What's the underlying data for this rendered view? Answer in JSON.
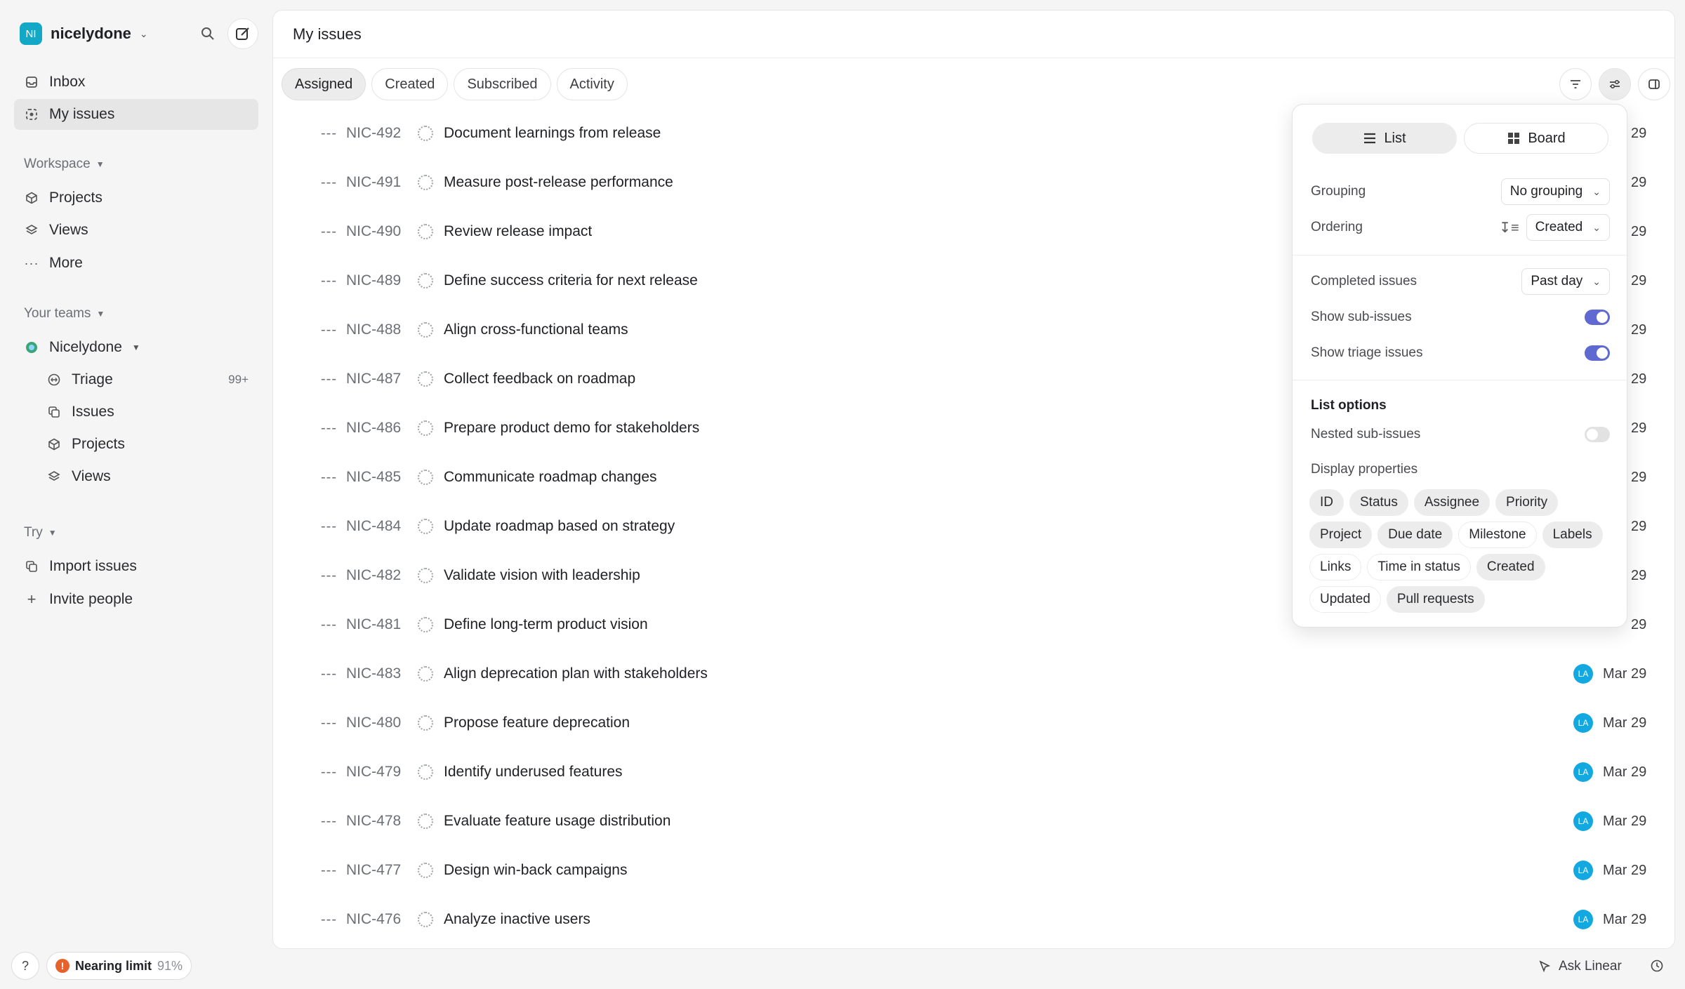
{
  "workspace": {
    "initials": "NI",
    "name": "nicelydone"
  },
  "nav": {
    "inbox": "Inbox",
    "my_issues": "My issues",
    "workspace_label": "Workspace",
    "projects": "Projects",
    "views": "Views",
    "more": "More",
    "your_teams_label": "Your teams",
    "team_name": "Nicelydone",
    "triage": "Triage",
    "triage_count": "99+",
    "issues": "Issues",
    "team_projects": "Projects",
    "team_views": "Views",
    "try_label": "Try",
    "import_issues": "Import issues",
    "invite_people": "Invite people"
  },
  "footer": {
    "help": "?",
    "limit_label": "Nearing limit",
    "limit_pct": "91%",
    "ask_linear": "Ask Linear"
  },
  "header": {
    "title": "My issues"
  },
  "tabs": [
    {
      "label": "Assigned"
    },
    {
      "label": "Created"
    },
    {
      "label": "Subscribed"
    },
    {
      "label": "Activity"
    }
  ],
  "issues": [
    {
      "id": "NIC-492",
      "title": "Document learnings from release",
      "date": "29"
    },
    {
      "id": "NIC-491",
      "title": "Measure post-release performance",
      "date": "29"
    },
    {
      "id": "NIC-490",
      "title": "Review release impact",
      "date": "29"
    },
    {
      "id": "NIC-489",
      "title": "Define success criteria for next release",
      "date": "29"
    },
    {
      "id": "NIC-488",
      "title": "Align cross-functional teams",
      "date": "29"
    },
    {
      "id": "NIC-487",
      "title": "Collect feedback on roadmap",
      "date": "29"
    },
    {
      "id": "NIC-486",
      "title": "Prepare product demo for stakeholders",
      "date": "29"
    },
    {
      "id": "NIC-485",
      "title": "Communicate roadmap changes",
      "date": "29"
    },
    {
      "id": "NIC-484",
      "title": "Update roadmap based on strategy",
      "date": "29"
    },
    {
      "id": "NIC-482",
      "title": "Validate vision with leadership",
      "date": "29"
    },
    {
      "id": "NIC-481",
      "title": "Define long-term product vision",
      "date": "29"
    },
    {
      "id": "NIC-483",
      "title": "Align deprecation plan with stakeholders",
      "assignee": "LA",
      "date": "Mar 29"
    },
    {
      "id": "NIC-480",
      "title": "Propose feature deprecation",
      "assignee": "LA",
      "date": "Mar 29"
    },
    {
      "id": "NIC-479",
      "title": "Identify underused features",
      "assignee": "LA",
      "date": "Mar 29"
    },
    {
      "id": "NIC-478",
      "title": "Evaluate feature usage distribution",
      "assignee": "LA",
      "date": "Mar 29"
    },
    {
      "id": "NIC-477",
      "title": "Design win-back campaigns",
      "assignee": "LA",
      "date": "Mar 29"
    },
    {
      "id": "NIC-476",
      "title": "Analyze inactive users",
      "assignee": "LA",
      "date": "Mar 29"
    }
  ],
  "display_options": {
    "list_label": "List",
    "board_label": "Board",
    "grouping_label": "Grouping",
    "grouping_value": "No grouping",
    "ordering_label": "Ordering",
    "ordering_value": "Created",
    "completed_label": "Completed issues",
    "completed_value": "Past day",
    "show_sub_issues_label": "Show sub-issues",
    "show_sub_issues": true,
    "show_triage_label": "Show triage issues",
    "show_triage": true,
    "list_options_label": "List options",
    "nested_sub_issues_label": "Nested sub-issues",
    "nested_sub_issues": false,
    "display_properties_label": "Display properties",
    "properties": [
      {
        "label": "ID",
        "on": true
      },
      {
        "label": "Status",
        "on": true
      },
      {
        "label": "Assignee",
        "on": true
      },
      {
        "label": "Priority",
        "on": true
      },
      {
        "label": "Project",
        "on": true
      },
      {
        "label": "Due date",
        "on": true
      },
      {
        "label": "Milestone",
        "on": false
      },
      {
        "label": "Labels",
        "on": true
      },
      {
        "label": "Links",
        "on": false
      },
      {
        "label": "Time in status",
        "on": false
      },
      {
        "label": "Created",
        "on": true
      },
      {
        "label": "Updated",
        "on": false
      },
      {
        "label": "Pull requests",
        "on": true
      }
    ]
  },
  "colors": {
    "accent": "#5e6ad2",
    "avatar": "#14a8e0",
    "warning": "#e5622d"
  }
}
